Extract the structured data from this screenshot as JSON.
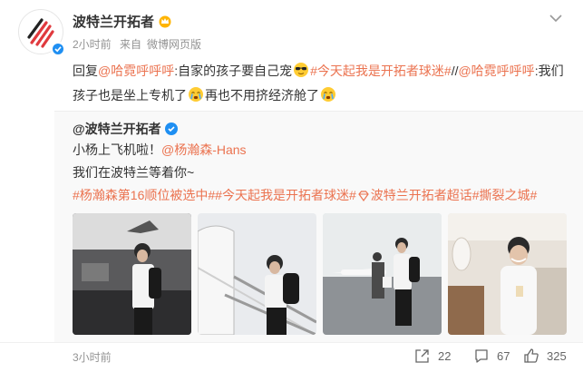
{
  "post": {
    "author": "波特兰开拓者",
    "time": "2小时前",
    "source_prefix": "来自",
    "source": "微博网页版",
    "reply_prefix": "回复",
    "mention1": "@哈霓呼呼呼",
    "text1_a": ":自家的孩子要自己宠",
    "topic1": "#今天起我是开拓者球迷#",
    "sep": "//",
    "mention2": "@哈霓呼呼呼",
    "text1_b": ":我们孩子也是坐上专机了",
    "text1_c": "再也不用挤经济舱了"
  },
  "repost": {
    "author": "@波特兰开拓者",
    "line1_text": "小杨上飞机啦！",
    "line1_mention": "@杨瀚森-Hans",
    "line2": "我们在波特兰等着你~",
    "topic1": "#杨瀚森第16顺位被选中#",
    "topic2": "#今天起我是开拓者球迷#",
    "supertopic": "波特兰开拓者超话",
    "topic3": "#撕裂之城#",
    "photos": [
      "photo-airport",
      "photo-boarding",
      "photo-tarmac",
      "photo-cabin"
    ]
  },
  "footer": {
    "time": "3小时前",
    "reposts": "22",
    "comments": "67",
    "likes": "325"
  },
  "colors": {
    "link": "#eb7350",
    "verified": "#1f8ff2",
    "meta": "#939393"
  }
}
